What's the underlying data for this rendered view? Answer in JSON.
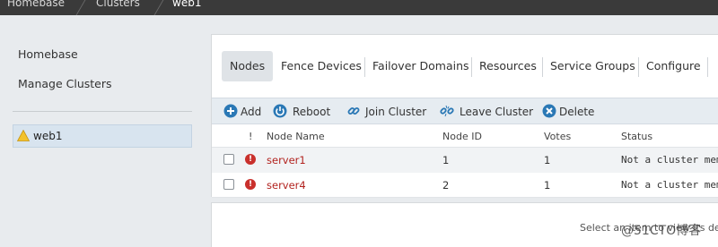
{
  "breadcrumb": [
    "Homebase",
    "Clusters",
    "web1"
  ],
  "sidebar": {
    "links": [
      "Homebase",
      "Manage Clusters"
    ],
    "cluster_name": "web1"
  },
  "tabs": [
    "Nodes",
    "Fence Devices",
    "Failover Domains",
    "Resources",
    "Service Groups",
    "Configure"
  ],
  "toolbar": {
    "add": "Add",
    "reboot": "Reboot",
    "join": "Join Cluster",
    "leave": "Leave Cluster",
    "delete": "Delete"
  },
  "table": {
    "headers": [
      "!",
      "Node Name",
      "Node ID",
      "Votes",
      "Status"
    ],
    "rows": [
      {
        "name": "server1",
        "id": "1",
        "votes": "1",
        "status": "Not a cluster membe"
      },
      {
        "name": "server4",
        "id": "2",
        "votes": "1",
        "status": "Not a cluster membe"
      }
    ]
  },
  "detail_hint": "Select an item to view its details",
  "watermark": "@51CTO博客",
  "colors": {
    "accent": "#2a78b5",
    "error": "#c9302c",
    "link": "#b2221e"
  }
}
